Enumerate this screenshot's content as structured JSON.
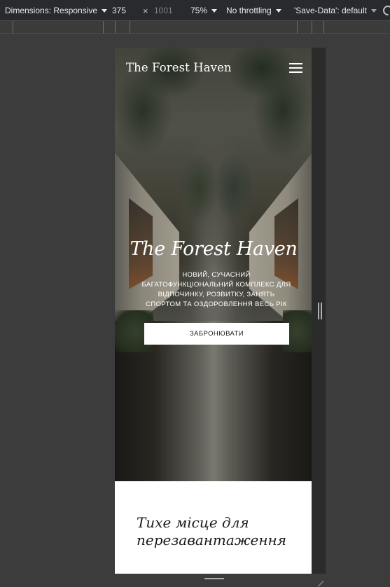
{
  "devtools": {
    "dimensions_label": "Dimensions: Responsive",
    "width_value": "375",
    "times_symbol": "×",
    "height_placeholder": "1001",
    "zoom": "75%",
    "throttling": "No throttling",
    "save_data": "'Save-Data': default"
  },
  "site": {
    "logo": "The Forest Haven",
    "hero": {
      "title": "The Forest Haven",
      "subtitle": "НОВИЙ, СУЧАСНИЙ БАГАТОФУНКЦІОНАЛЬНИЙ КОМПЛЕКС ДЛЯ ВІДПОЧИНКУ, РОЗВИТКУ, ЗАНЯТЬ СПОРТОМ ТА ОЗДОРОВЛЕННЯ ВЕСЬ РІК",
      "cta": "ЗАБРОНЮВАТИ"
    },
    "section": {
      "title": "Тихе місце для перезавантаження"
    }
  },
  "icons": {
    "menu": "hamburger-menu-icon",
    "rotate": "rotate-device-icon"
  }
}
